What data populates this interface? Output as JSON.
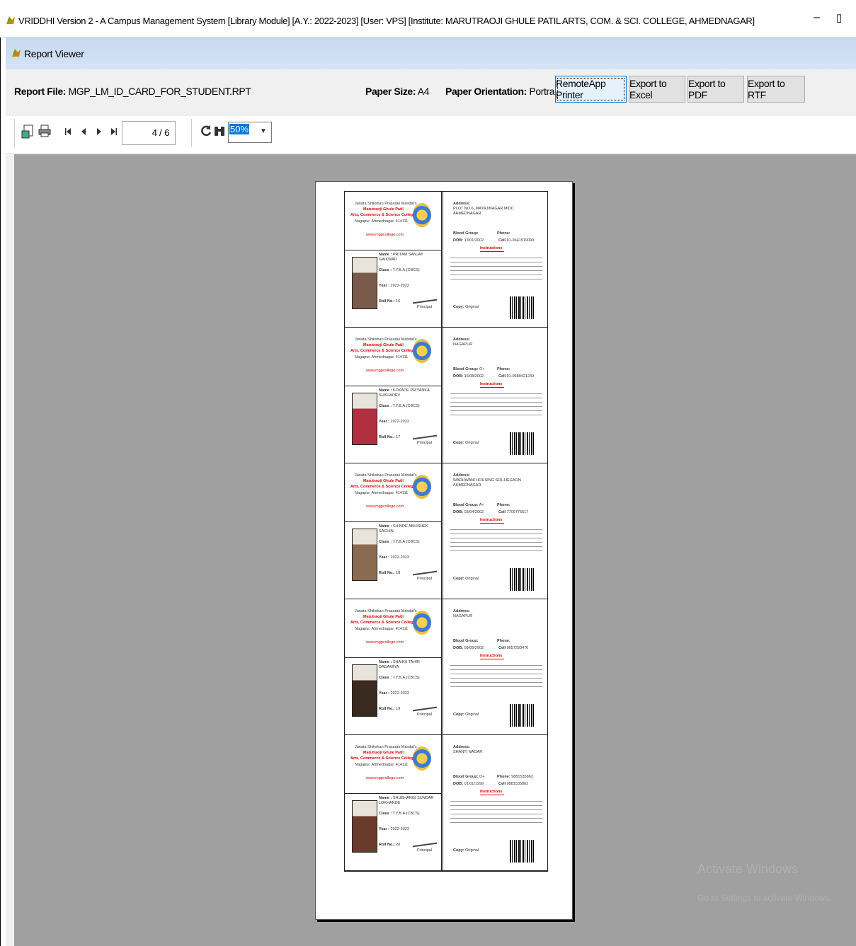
{
  "window": {
    "title": "VRIDDHI Version 2 - A Campus Management System [Library Module] [A.Y.: 2022-2023] [User: VPS] [Institute: MARUTRAOJI GHULE PATIL ARTS, COM. & SCI. COLLEGE, AHMEDNAGAR]",
    "minimize": "–",
    "restore": "▯"
  },
  "child_window": {
    "title": "Report Viewer"
  },
  "report_bar": {
    "file_label": "Report File:",
    "file_value": "MGP_LM_ID_CARD_FOR_STUDENT.RPT",
    "paper_size_label": "Paper Size:",
    "paper_size_value": "A4",
    "orientation_label": "Paper Orientation:",
    "orientation_value": "Portrait",
    "buttons": [
      "RemoteApp Printer",
      "Export to Excel",
      "Export to PDF",
      "Export to RTF"
    ]
  },
  "toolbar": {
    "current_page": "4",
    "total_pages": "/ 6",
    "zoom": "50%",
    "icons": [
      "export-icon",
      "print-icon",
      "first-page-icon",
      "prev-page-icon",
      "next-page-icon",
      "last-page-icon",
      "refresh-icon",
      "search-icon"
    ]
  },
  "cards": [
    {
      "name": "PRITAM SANJAY GAIKWAD",
      "class": "T.Y.B.A.(CBCS)",
      "year": "2022-2023",
      "roll": "16",
      "address": "PLOT NO.6 ,MAYAJINAGAR MIDC AHMEDNAGAR",
      "blood": "",
      "phone": "",
      "cell": "91-9641519090",
      "dob": "13/01/2002",
      "copy": "Original"
    },
    {
      "name": "KOKADE PRIYANKA SUKHADEV",
      "class": "T.Y.B.A.(CBCS)",
      "year": "2022-2023",
      "roll": "17",
      "address": "NAGAPUR",
      "blood": "O+",
      "phone": "",
      "cell": "91-9689421249",
      "dob": "16/08/2002",
      "copy": "Original"
    },
    {
      "name": "SHINDE ABHISHEK SACHIN",
      "class": "T.Y.B.A.(CBCS)",
      "year": "2022-2023",
      "roll": "18",
      "address": "WADHWANI HOUSING SOL.HEGAON AHMEDNAGAR",
      "blood": "A+",
      "phone": "",
      "cell": "7709775517",
      "dob": "03/04/2002",
      "copy": "Original"
    },
    {
      "name": "SHAIKH TAHIR DADAMIYA",
      "class": "T.Y.B.A.(CBCS)",
      "year": "2022-2023",
      "roll": "19",
      "address": "NAGAPUR",
      "blood": "",
      "phone": "",
      "cell": "9657293476",
      "dob": "09/09/2002",
      "copy": "Original"
    },
    {
      "name": "SHUBHANGI SUNDAR LOKHANDE",
      "class": "T.Y.B.A.(CBCS)",
      "year": "2022-2023",
      "roll": "20",
      "address": "SHANTI NAGAR",
      "blood": "O+",
      "phone": "9881535862",
      "cell": "9881535862",
      "dob": "01/01/1999",
      "copy": "Original"
    }
  ],
  "card_static": {
    "org_line1": "Janata Shikshan Prasarak Mandal's",
    "org_line2": "Marutraoji Ghule Patil",
    "org_line3": "Arts, Commerce & Science College",
    "org_line4": "Nagapur, Ahmednagar. 414111",
    "website": "www.mgpcollege.com",
    "name_label": "Name :",
    "class_label": "Class :",
    "year_label": "Year :",
    "roll_label": "Roll No.:",
    "principal": "Principal",
    "address_label": "Address:",
    "blood_label": "Blood Group:",
    "phone_label": "Phone:",
    "dob_label": "DOB:",
    "cell_label": "Cell",
    "instructions": "Instructions",
    "copy_label": "Copy:"
  },
  "watermark": {
    "line1": "Activate Windows",
    "line2": "Go to Settings to activate Windows."
  }
}
